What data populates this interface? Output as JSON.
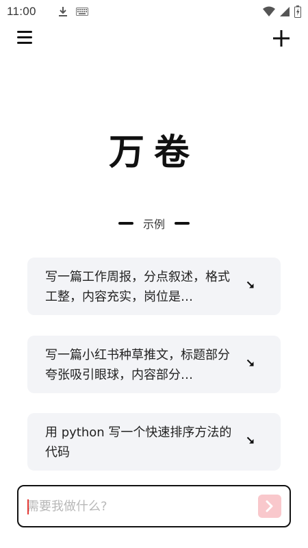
{
  "status_bar": {
    "time": "11:00",
    "icons": [
      "download-icon",
      "keyboard-icon",
      "wifi-icon",
      "signal-icon",
      "battery-icon"
    ]
  },
  "top_bar": {
    "menu_icon": "hamburger-menu-icon",
    "add_icon": "plus-icon"
  },
  "brand": {
    "title": "万卷"
  },
  "examples": {
    "heading": "示例",
    "items": [
      {
        "text": "写一篇工作周报，分点叙述，格式工整，内容充实，岗位是…"
      },
      {
        "text": "写一篇小红书种草推文，标题部分夸张吸引眼球，内容部分…"
      },
      {
        "text": "用 python 写一个快速排序方法的代码"
      }
    ],
    "arrow_icon": "arrow-down-right-icon"
  },
  "input": {
    "value": "",
    "placeholder": "需要我做什么?",
    "send_icon": "chevron-right-icon"
  },
  "colors": {
    "card_bg": "#f3f4f7",
    "send_button_bg": "#f9c8cc",
    "caret": "#e53935"
  }
}
